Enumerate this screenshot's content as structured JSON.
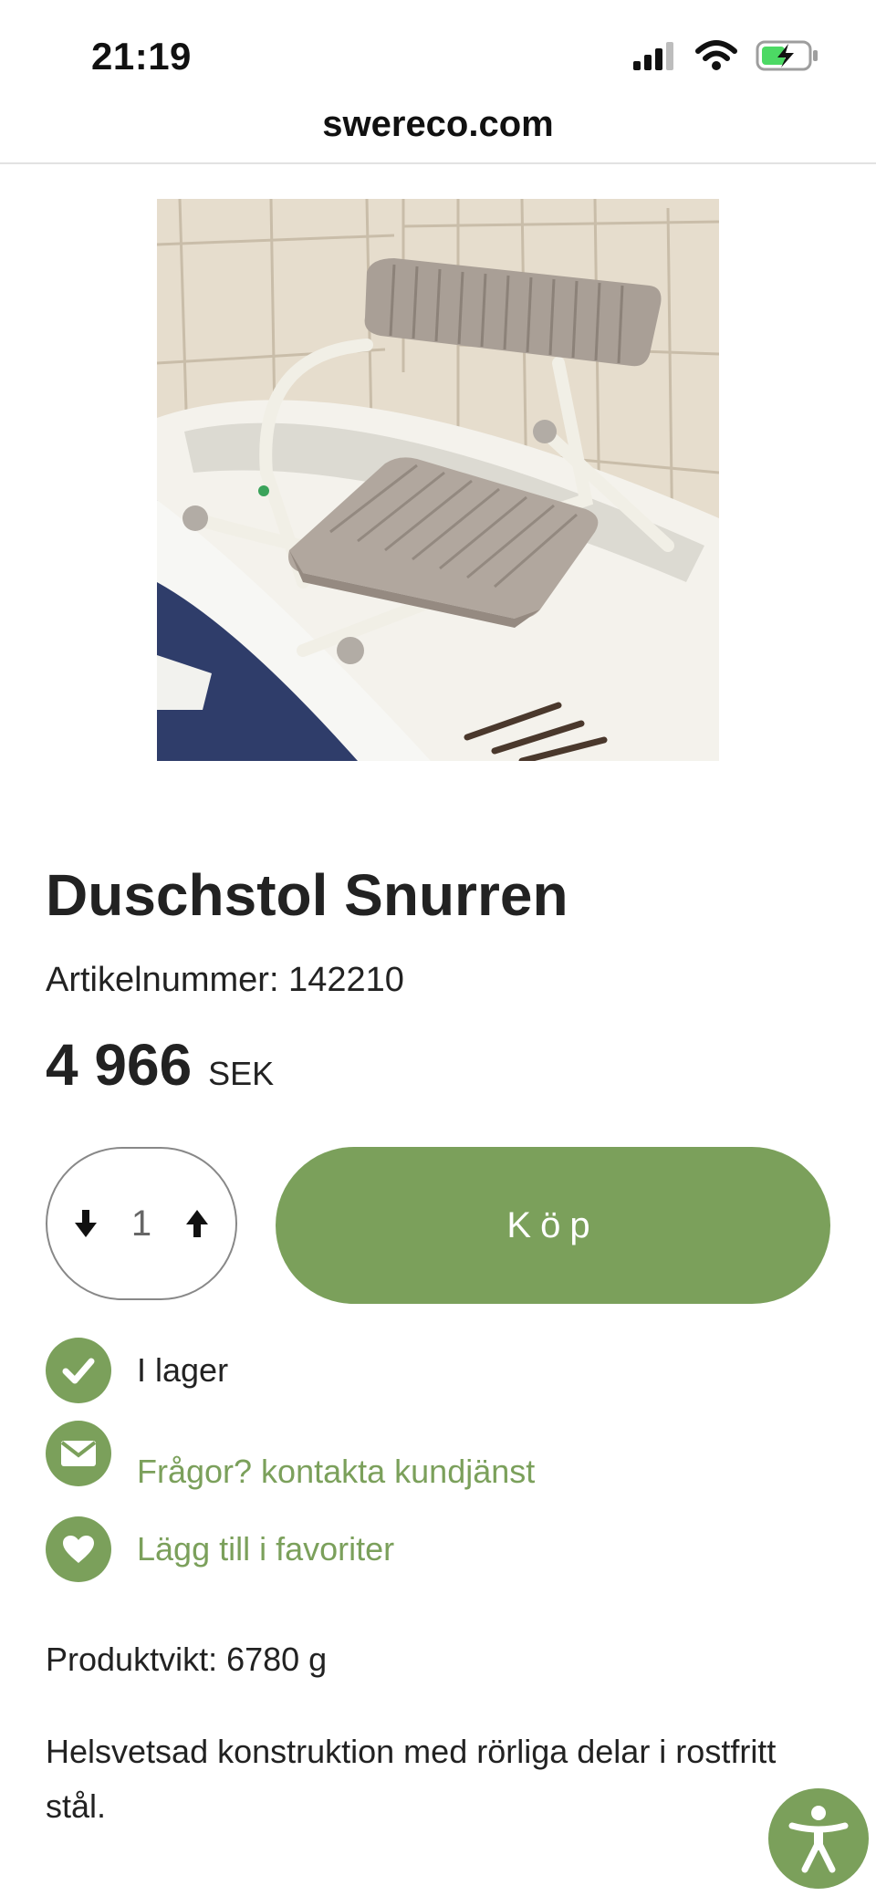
{
  "status_bar": {
    "time": "21:19",
    "icons": [
      "signal-icon",
      "wifi-icon",
      "battery-charging-icon"
    ]
  },
  "browser": {
    "url": "swereco.com"
  },
  "product": {
    "image_icon": "shower-chair-photo",
    "title": "Duschstol Snurren",
    "sku": "Artikelnummer: 142210",
    "price": "4 966",
    "currency": "SEK",
    "quantity": "1",
    "buy_label": "Köp",
    "features": {
      "stock": "I lager",
      "contact": "Frågor? kontakta kundjänst",
      "favorite": "Lägg till i favoriter"
    },
    "weight": "Produktvikt: 6780 g",
    "description": "Helsvetsad konstruktion med rörliga delar i rostfritt stål."
  },
  "colors": {
    "accent": "#7ba05b",
    "text": "#222222"
  }
}
